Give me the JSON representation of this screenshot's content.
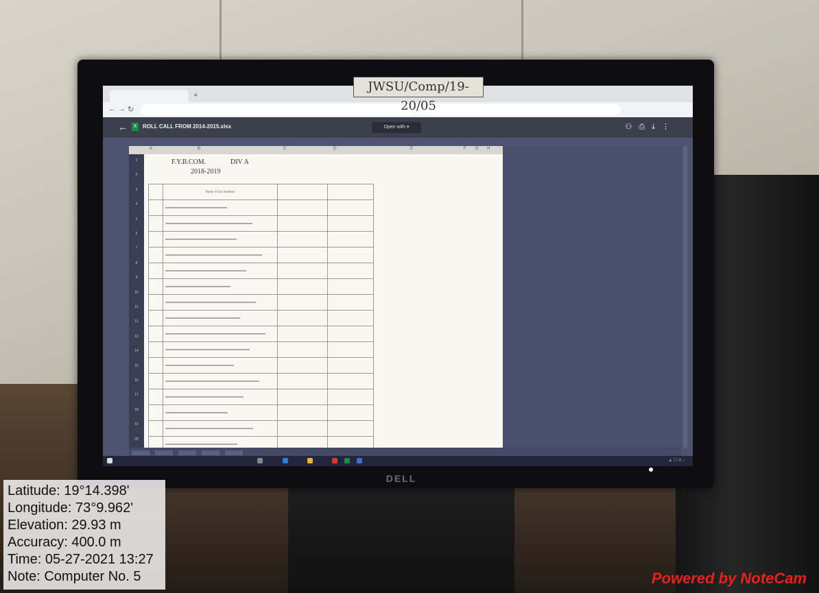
{
  "monitor_label": "JWSU/Comp/19-20/05",
  "monitor_brand": "DELL",
  "viewer": {
    "title": "ROLL CALL FROM 2014-2015.xlsx",
    "open_with": "Open with ▾"
  },
  "sheet": {
    "class": "F.Y.B.COM.",
    "division": "DIV A",
    "year": "2018-2019",
    "header_name": "Name of the Students",
    "columns": [
      "A",
      "B",
      "C",
      "D",
      "E",
      "F",
      "G",
      "H"
    ],
    "rows": [
      "1",
      "2",
      "3",
      "4",
      "5",
      "6",
      "7",
      "8",
      "9",
      "10",
      "11",
      "12",
      "13",
      "14",
      "15",
      "16",
      "17",
      "18",
      "19",
      "20"
    ]
  },
  "overlay": {
    "latitude": "Latitude: 19°14.398'",
    "longitude": "Longitude: 73°9.962'",
    "elevation": "Elevation: 29.93 m",
    "accuracy": "Accuracy: 400.0 m",
    "time": "Time: 05-27-2021 13:27",
    "note": "Note: Computer No. 5"
  },
  "watermark": "Powered by NoteCam",
  "colors": {
    "watermark": "#e8221b",
    "viewer_bg": "#4d5370",
    "sheet_bg": "#f8f7f2"
  }
}
